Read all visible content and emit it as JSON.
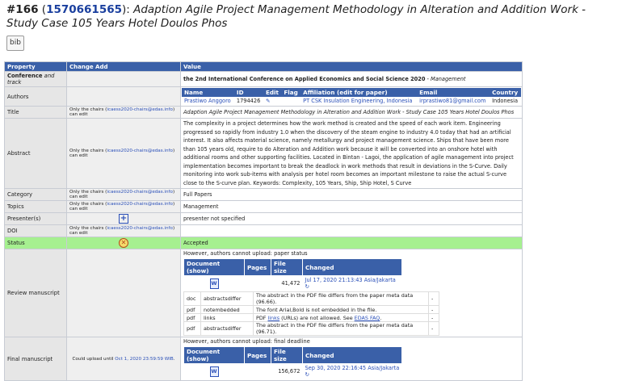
{
  "header": {
    "number": "#166",
    "paper_id": "1570661565",
    "title": "Adaption Agile Project Management Methodology in Alteration and Addition Work - Study Case 105 Years Hotel Doulos Phos"
  },
  "bib_label": "bib",
  "table": {
    "headers": {
      "property": "Property",
      "change_add": "Change Add",
      "value": "Value"
    },
    "conference": {
      "label_bold": "Conference",
      "label_rest": " and track",
      "value_bold": "the 2nd International Conference on Applied Economics and Social Science 2020",
      "value_rest": " - Management"
    },
    "authors": {
      "label": "Authors",
      "headers": {
        "name": "Name",
        "id": "ID",
        "edit": "Edit",
        "flag": "Flag",
        "affiliation": "Affiliation (edit for paper)",
        "email": "Email",
        "country": "Country"
      },
      "row": {
        "name": "Prastiwo Anggoro",
        "id": "1794426",
        "affiliation": "PT CSK Insulation Engineering, Indonesia",
        "email": "irprastiwo81@gmail.com",
        "country": "Indonesia"
      }
    },
    "title_row": {
      "label": "Title",
      "change_prefix": "Only the chairs (",
      "change_link": "icaess2020-chairs@edas.info",
      "change_suffix": ") can edit",
      "value": "Adaption Agile Project Management Methodology in Alteration and Addition Work - Study Case 105 Years Hotel Doulos Phos"
    },
    "abstract_row": {
      "label": "Abstract",
      "change_prefix": "Only the chairs (",
      "change_link": "icaess2020-chairs@edas.info",
      "change_suffix": ") can edit",
      "value": "The complexity in a project determines how the work method is created and the speed of each work item. Engineering progressed so rapidly from industry 1.0 when the discovery of the steam engine to industry 4.0 today that had an artificial interest. It also affects material science, namely metallurgy and project management science. Ships that have been more than 105 years old, require to do Alteration and Addition work because it will be converted into an onshore hotel with additional rooms and other supporting facilities. Located in Bintan - Lagoi, the application of agile management into project implementation becomes important to break the deadlock in work methods that result in deviations in the S-Curve. Daily monitoring into work sub-items with analysis per hotel room becomes an important milestone to raise the actual S-curve close to the S-curve plan. Keywords: Complexity, 105 Years, Ship, Ship Hotel, S Curve"
    },
    "category_row": {
      "label": "Category",
      "change_prefix": "Only the chairs (",
      "change_link": "icaess2020-chairs@edas.info",
      "change_suffix": ") can edit",
      "value": "Full Papers"
    },
    "topics_row": {
      "label": "Topics",
      "change_prefix": "Only the chairs (",
      "change_link": "icaess2020-chairs@edas.info",
      "change_suffix": ") can edit",
      "value": "Management"
    },
    "presenter_row": {
      "label": "Presenter(s)",
      "value": "presenter not specified"
    },
    "doi_row": {
      "label": "DOI",
      "change_prefix": "Only the chairs (",
      "change_link": "icaess2020-chairs@edas.info",
      "change_suffix": ") can edit",
      "value": ""
    },
    "status_row": {
      "label": "Status",
      "value": "Accepted"
    },
    "review_row": {
      "label": "Review manuscript",
      "note": "However, authors cannot upload: paper status",
      "doc_headers": {
        "document": "Document (show)",
        "pages": "Pages",
        "size": "File size",
        "changed": "Changed"
      },
      "doc": {
        "size": "41,472",
        "changed": "Jul 17, 2020 21:13:43 Asia/Jakarta"
      },
      "issues": [
        {
          "type": "doc",
          "code": "abstractsdiffer",
          "msg": "The abstract in the PDF file differs from the paper meta data (96.66).",
          "mark": "-"
        },
        {
          "type": "pdf",
          "code": "notembedded",
          "msg": "The font Arial,Bold is not embedded in the file.",
          "mark": "-"
        },
        {
          "type": "pdf",
          "code": "links",
          "msg_pre": "PDF ",
          "msg_link": "links",
          "msg_mid": " (URLs) are not allowed. See ",
          "msg_link2": "EDAS FAQ",
          "msg_post": ".",
          "mark": "-"
        },
        {
          "type": "pdf",
          "code": "abstractsdiffer",
          "msg": "The abstract in the PDF file differs from the paper meta data (96.71).",
          "mark": "-"
        }
      ]
    },
    "final_row": {
      "label": "Final manuscript",
      "change_prefix": "Could upload until ",
      "change_link": "Oct 1, 2020 23:59:59 WIB",
      "change_suffix": ".",
      "note": "However, authors cannot upload: final deadline",
      "doc_headers": {
        "document": "Document (show)",
        "pages": "Pages",
        "size": "File size",
        "changed": "Changed"
      },
      "doc": {
        "size": "156,672",
        "changed": "Sep 30, 2020 22:16:45 Asia/Jakarta"
      }
    }
  },
  "colors": {
    "header_blue": "#3a60a8",
    "status_green": "#a6f090",
    "link_blue": "#2a4fb8"
  },
  "icons": [
    "bib-icon",
    "edit-icon",
    "plus-icon",
    "status-x-icon",
    "pdf-icon",
    "history-icon"
  ]
}
